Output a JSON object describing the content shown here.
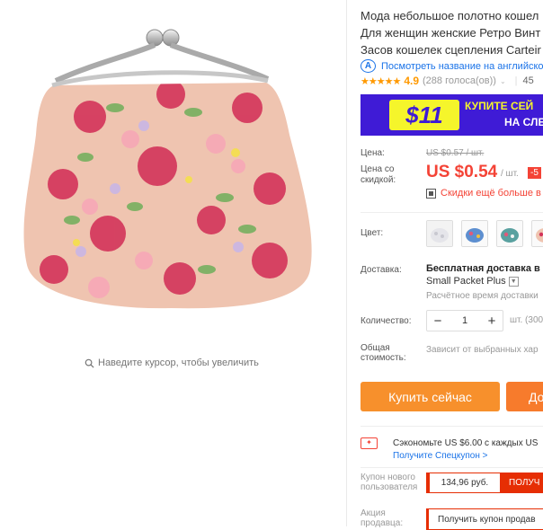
{
  "product": {
    "title_lines": [
      "Мода небольшое полотно кошел",
      "Для женщин женские Ретро Винт",
      "Засов кошелек сцепления Carteir"
    ],
    "translate_link": "Посмотреть название на английско",
    "rating_value": "4.9",
    "rating_count": "(288 голоса(ов))",
    "orders_prefix": "45"
  },
  "image": {
    "zoom_hint": "Наведите курсор, чтобы увеличить"
  },
  "promo": {
    "badge": "$11",
    "line1": "КУПИТЕ СЕЙ",
    "line2": "НА СЛЕ"
  },
  "price": {
    "label": "Цена:",
    "original": "US $0.57 / шт.",
    "sale_label_line1": "Цена со",
    "sale_label_line2": "скидкой:",
    "sale": "US $0.54",
    "per_unit": "/ шт.",
    "discount_badge": "-5",
    "bulk_text": "Скидки ещё больше в п"
  },
  "color": {
    "label": "Цвет:"
  },
  "shipping": {
    "label": "Доставка:",
    "title": "Бесплатная доставка в R",
    "method": "Small Packet Plus",
    "time": "Расчётное время доставки"
  },
  "quantity": {
    "label": "Количество:",
    "value": "1",
    "minus": "−",
    "plus": "+",
    "unit": "шт. (300"
  },
  "total": {
    "label_line1": "Общая",
    "label_line2": "стоимость:",
    "value": "Зависит от выбранных хар"
  },
  "actions": {
    "buy_now": "Купить сейчас",
    "add_to_cart": "До"
  },
  "coupons": {
    "save_text": "Сэкономьте US $6.00 с каждых US",
    "get_coupon": "Получите Спецкупон >",
    "new_user_label_line1": "Купон нового",
    "new_user_label_line2": "пользователя",
    "new_user_amount": "134,96 руб.",
    "new_user_button": "ПОЛУЧ",
    "seller_label_line1": "Акция",
    "seller_label_line2": "продавца:",
    "seller_button": "Получить купон продав"
  },
  "colors": {
    "accent_red": "#f44336",
    "buy_orange": "#f7902c",
    "promo_blue": "#3f1bd6",
    "promo_yellow": "#f5f52b",
    "link_blue": "#1a73e8",
    "star_orange": "#ff9900"
  },
  "icons": {
    "zoom": "magnifier-icon",
    "translate": "ai-translate-icon",
    "bulk": "qr-icon",
    "coupon": "coupon-ticket-icon"
  }
}
